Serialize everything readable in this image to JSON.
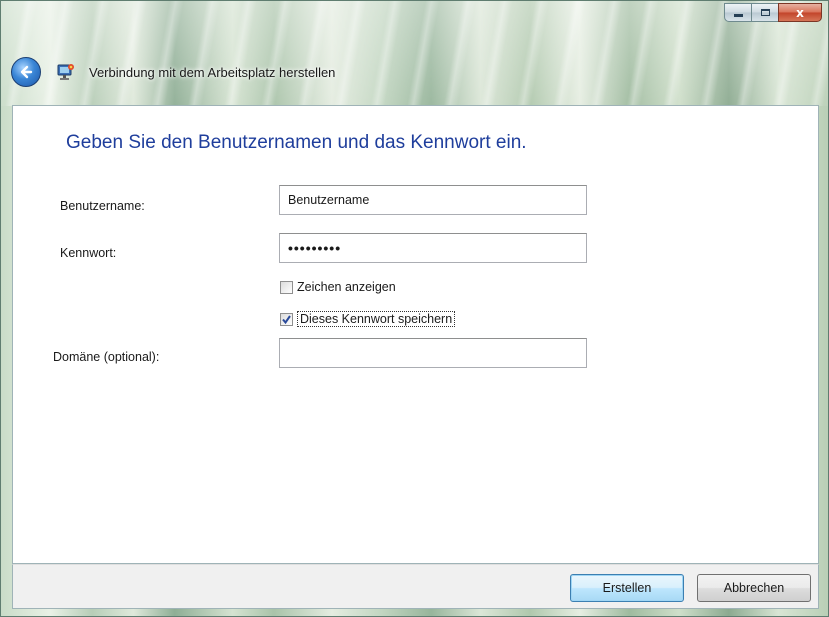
{
  "window": {
    "title": "Verbindung mit dem Arbeitsplatz herstellen",
    "controls": {
      "minimize_icon": "minimize-icon",
      "maximize_icon": "maximize-icon",
      "close_label": "x"
    }
  },
  "nav": {
    "back_icon": "back-arrow-icon",
    "app_icon": "remote-desktop-icon"
  },
  "form": {
    "heading": "Geben Sie den Benutzernamen und das Kennwort ein.",
    "username": {
      "label": "Benutzername:",
      "value": "Benutzername"
    },
    "password": {
      "label": "Kennwort:",
      "value": "•••••••••"
    },
    "show_chars": {
      "label": "Zeichen anzeigen",
      "checked": false
    },
    "save_password": {
      "label": "Dieses Kennwort speichern",
      "checked": true
    },
    "domain": {
      "label": "Domäne (optional):",
      "value": ""
    }
  },
  "buttons": {
    "create": "Erstellen",
    "cancel": "Abbrechen"
  },
  "colors": {
    "heading": "#1f3e9c",
    "default_button_border": "#3c7fb1",
    "close_button": "#c2442a"
  }
}
